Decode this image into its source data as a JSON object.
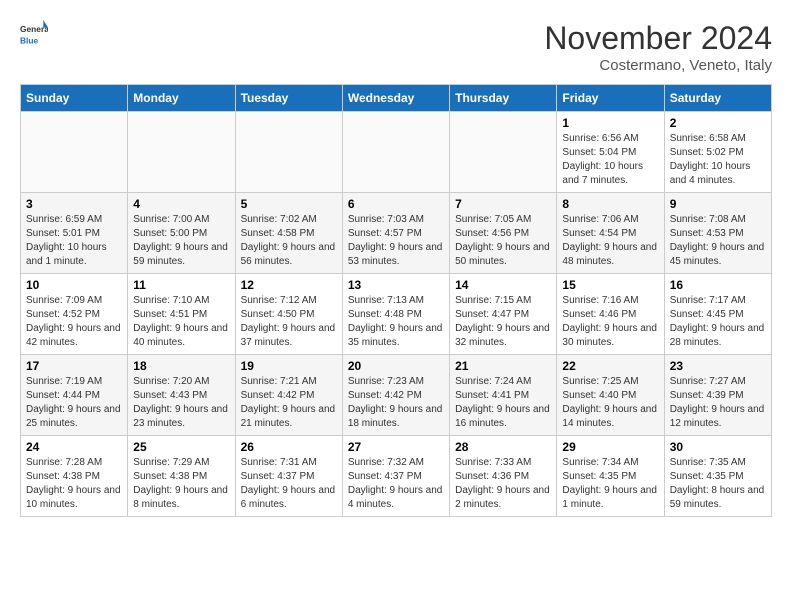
{
  "logo": {
    "general": "General",
    "blue": "Blue"
  },
  "title": "November 2024",
  "subtitle": "Costermano, Veneto, Italy",
  "days_header": [
    "Sunday",
    "Monday",
    "Tuesday",
    "Wednesday",
    "Thursday",
    "Friday",
    "Saturday"
  ],
  "weeks": [
    [
      {
        "day": "",
        "info": ""
      },
      {
        "day": "",
        "info": ""
      },
      {
        "day": "",
        "info": ""
      },
      {
        "day": "",
        "info": ""
      },
      {
        "day": "",
        "info": ""
      },
      {
        "day": "1",
        "info": "Sunrise: 6:56 AM\nSunset: 5:04 PM\nDaylight: 10 hours and 7 minutes."
      },
      {
        "day": "2",
        "info": "Sunrise: 6:58 AM\nSunset: 5:02 PM\nDaylight: 10 hours and 4 minutes."
      }
    ],
    [
      {
        "day": "3",
        "info": "Sunrise: 6:59 AM\nSunset: 5:01 PM\nDaylight: 10 hours and 1 minute."
      },
      {
        "day": "4",
        "info": "Sunrise: 7:00 AM\nSunset: 5:00 PM\nDaylight: 9 hours and 59 minutes."
      },
      {
        "day": "5",
        "info": "Sunrise: 7:02 AM\nSunset: 4:58 PM\nDaylight: 9 hours and 56 minutes."
      },
      {
        "day": "6",
        "info": "Sunrise: 7:03 AM\nSunset: 4:57 PM\nDaylight: 9 hours and 53 minutes."
      },
      {
        "day": "7",
        "info": "Sunrise: 7:05 AM\nSunset: 4:56 PM\nDaylight: 9 hours and 50 minutes."
      },
      {
        "day": "8",
        "info": "Sunrise: 7:06 AM\nSunset: 4:54 PM\nDaylight: 9 hours and 48 minutes."
      },
      {
        "day": "9",
        "info": "Sunrise: 7:08 AM\nSunset: 4:53 PM\nDaylight: 9 hours and 45 minutes."
      }
    ],
    [
      {
        "day": "10",
        "info": "Sunrise: 7:09 AM\nSunset: 4:52 PM\nDaylight: 9 hours and 42 minutes."
      },
      {
        "day": "11",
        "info": "Sunrise: 7:10 AM\nSunset: 4:51 PM\nDaylight: 9 hours and 40 minutes."
      },
      {
        "day": "12",
        "info": "Sunrise: 7:12 AM\nSunset: 4:50 PM\nDaylight: 9 hours and 37 minutes."
      },
      {
        "day": "13",
        "info": "Sunrise: 7:13 AM\nSunset: 4:48 PM\nDaylight: 9 hours and 35 minutes."
      },
      {
        "day": "14",
        "info": "Sunrise: 7:15 AM\nSunset: 4:47 PM\nDaylight: 9 hours and 32 minutes."
      },
      {
        "day": "15",
        "info": "Sunrise: 7:16 AM\nSunset: 4:46 PM\nDaylight: 9 hours and 30 minutes."
      },
      {
        "day": "16",
        "info": "Sunrise: 7:17 AM\nSunset: 4:45 PM\nDaylight: 9 hours and 28 minutes."
      }
    ],
    [
      {
        "day": "17",
        "info": "Sunrise: 7:19 AM\nSunset: 4:44 PM\nDaylight: 9 hours and 25 minutes."
      },
      {
        "day": "18",
        "info": "Sunrise: 7:20 AM\nSunset: 4:43 PM\nDaylight: 9 hours and 23 minutes."
      },
      {
        "day": "19",
        "info": "Sunrise: 7:21 AM\nSunset: 4:42 PM\nDaylight: 9 hours and 21 minutes."
      },
      {
        "day": "20",
        "info": "Sunrise: 7:23 AM\nSunset: 4:42 PM\nDaylight: 9 hours and 18 minutes."
      },
      {
        "day": "21",
        "info": "Sunrise: 7:24 AM\nSunset: 4:41 PM\nDaylight: 9 hours and 16 minutes."
      },
      {
        "day": "22",
        "info": "Sunrise: 7:25 AM\nSunset: 4:40 PM\nDaylight: 9 hours and 14 minutes."
      },
      {
        "day": "23",
        "info": "Sunrise: 7:27 AM\nSunset: 4:39 PM\nDaylight: 9 hours and 12 minutes."
      }
    ],
    [
      {
        "day": "24",
        "info": "Sunrise: 7:28 AM\nSunset: 4:38 PM\nDaylight: 9 hours and 10 minutes."
      },
      {
        "day": "25",
        "info": "Sunrise: 7:29 AM\nSunset: 4:38 PM\nDaylight: 9 hours and 8 minutes."
      },
      {
        "day": "26",
        "info": "Sunrise: 7:31 AM\nSunset: 4:37 PM\nDaylight: 9 hours and 6 minutes."
      },
      {
        "day": "27",
        "info": "Sunrise: 7:32 AM\nSunset: 4:37 PM\nDaylight: 9 hours and 4 minutes."
      },
      {
        "day": "28",
        "info": "Sunrise: 7:33 AM\nSunset: 4:36 PM\nDaylight: 9 hours and 2 minutes."
      },
      {
        "day": "29",
        "info": "Sunrise: 7:34 AM\nSunset: 4:35 PM\nDaylight: 9 hours and 1 minute."
      },
      {
        "day": "30",
        "info": "Sunrise: 7:35 AM\nSunset: 4:35 PM\nDaylight: 8 hours and 59 minutes."
      }
    ]
  ]
}
